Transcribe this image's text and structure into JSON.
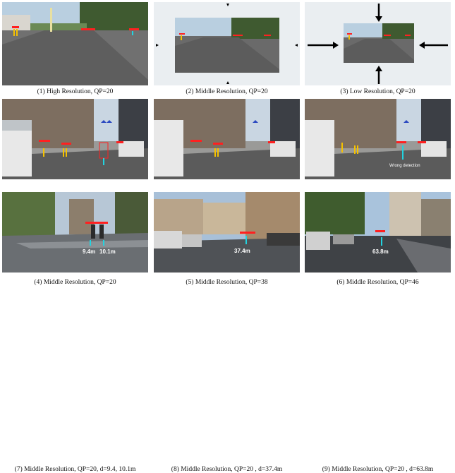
{
  "figure": {
    "panels": [
      {
        "caption": "(1) High Resolution, QP=20"
      },
      {
        "caption": "(2) Middle Resolution, QP=20"
      },
      {
        "caption": "(3) Low Resolution, QP=20"
      },
      {
        "caption": "(4) Middle Resolution, QP=20"
      },
      {
        "caption": "(5) Middle Resolution, QP=38"
      },
      {
        "caption": "(6) Middle Resolution, QP=46",
        "annotation": "Wrong detection"
      },
      {
        "caption": "(7) Middle Resolution, QP=20, d=9.4, 10.1m",
        "distances": [
          "9.4m",
          "10.1m"
        ]
      },
      {
        "caption": "(8) Middle Resolution, QP=20 , d=37.4m",
        "distances": [
          "37.4m"
        ]
      },
      {
        "caption": "(9) Middle Resolution, QP=20 , d=63.8m",
        "distances": [
          "63.8m"
        ]
      }
    ]
  },
  "colors": {
    "detection_box": "#ff2020",
    "person_marker": "#f5c200",
    "distance_arrow": "#22d3e0",
    "scale_arrow": "#000000"
  }
}
